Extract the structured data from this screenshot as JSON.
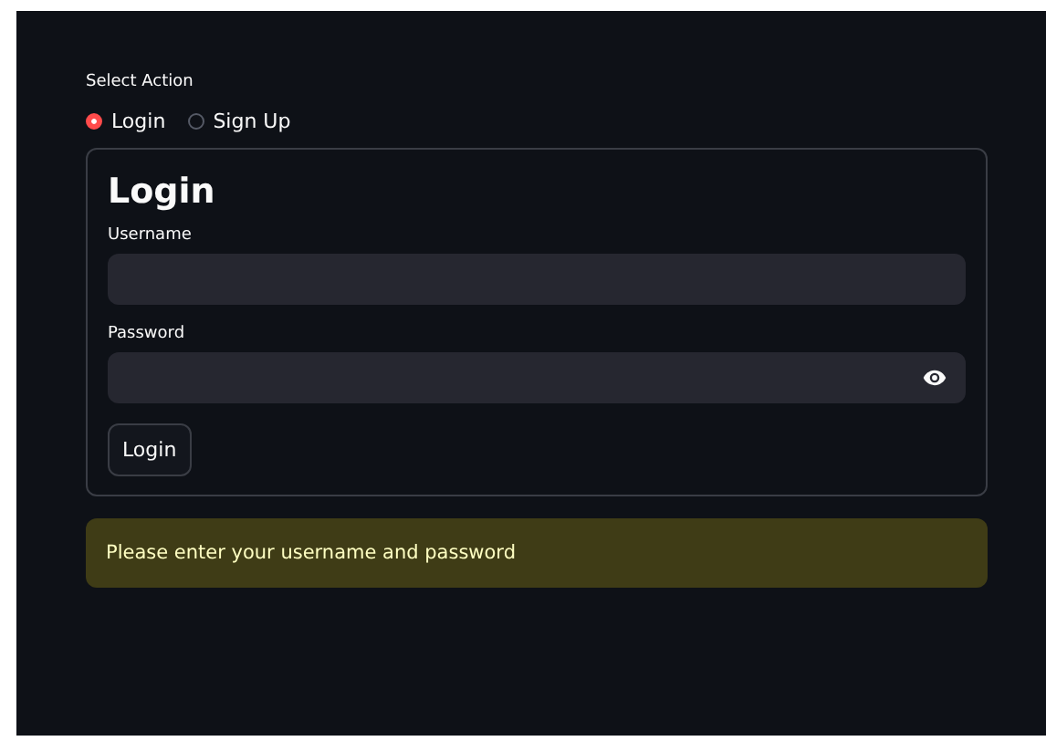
{
  "action": {
    "label": "Select Action",
    "options": [
      {
        "label": "Login",
        "selected": true
      },
      {
        "label": "Sign Up",
        "selected": false
      }
    ]
  },
  "form": {
    "title": "Login",
    "fields": [
      {
        "label": "Username",
        "kind": "text"
      },
      {
        "label": "Password",
        "kind": "password"
      }
    ],
    "button": "Login"
  },
  "warning": "Please enter your username and password"
}
